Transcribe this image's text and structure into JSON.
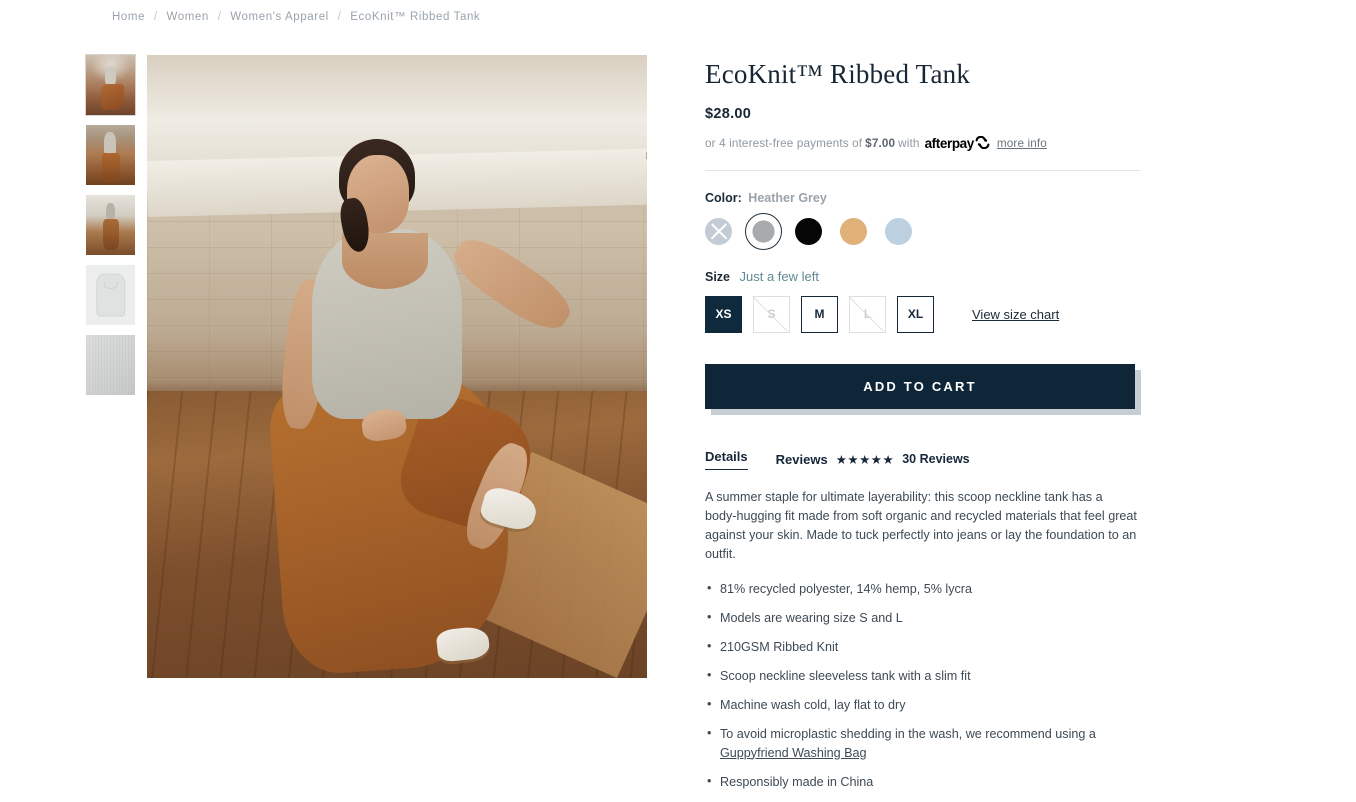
{
  "breadcrumb": {
    "items": [
      "Home",
      "Women",
      "Women's Apparel",
      "EcoKnit™ Ribbed Tank"
    ],
    "separator": "/"
  },
  "gallery": {
    "thumbnails": [
      {
        "name": "model-seated-front",
        "alt": "Model seated against wall wearing tank"
      },
      {
        "name": "model-back-view",
        "alt": "Back view of model in tank"
      },
      {
        "name": "model-standing-window",
        "alt": "Model standing near window"
      },
      {
        "name": "product-flat-lay",
        "alt": "Flat lay of heather grey ribbed tank"
      },
      {
        "name": "fabric-closeup",
        "alt": "Close up of ribbed knit fabric"
      }
    ],
    "hero_alt": "Model in heather grey ribbed tank and rust trousers seated on wooden floor"
  },
  "product": {
    "title": "EcoKnit™ Ribbed Tank",
    "price": "$28.00"
  },
  "afterpay": {
    "prefix": "or 4 interest-free payments of",
    "installment": "$7.00",
    "with": "with",
    "brand": "afterpay",
    "more_info": "more info"
  },
  "color": {
    "label": "Color:",
    "selected": "Heather Grey",
    "swatches": [
      {
        "name": "white",
        "hex": "#c3ccd4",
        "state": "disabled"
      },
      {
        "name": "Heather Grey",
        "hex": "#a9aaac",
        "state": "selected"
      },
      {
        "name": "Black",
        "hex": "#060606",
        "state": "available"
      },
      {
        "name": "Tan",
        "hex": "#e0b178",
        "state": "available"
      },
      {
        "name": "Light Blue",
        "hex": "#bdd0e0",
        "state": "available"
      }
    ]
  },
  "size": {
    "label": "Size",
    "stock_note": "Just a few left",
    "options": [
      {
        "label": "XS",
        "state": "selected"
      },
      {
        "label": "S",
        "state": "soldout"
      },
      {
        "label": "M",
        "state": "available"
      },
      {
        "label": "L",
        "state": "soldout"
      },
      {
        "label": "XL",
        "state": "available"
      }
    ],
    "size_chart_link": "View size chart"
  },
  "cart": {
    "add_to_cart": "ADD TO CART"
  },
  "tabs": {
    "details": "Details",
    "reviews": "Reviews",
    "stars": "★★★★★",
    "review_count": "30 Reviews"
  },
  "details": {
    "description": "A summer staple for ultimate layerability: this scoop neckline tank has a body-hugging fit made from soft organic and recycled materials that feel great against your skin. Made to tuck perfectly into jeans or lay the foundation to an outfit.",
    "bullets": [
      {
        "text": "81% recycled polyester, 14% hemp, 5% lycra"
      },
      {
        "text": "Models are wearing size S and L"
      },
      {
        "text": "210GSM Ribbed Knit"
      },
      {
        "text": "Scoop neckline sleeveless tank with a slim fit"
      },
      {
        "text": "Machine wash cold, lay flat to dry"
      },
      {
        "text": "To avoid microplastic shedding in the wash, we recommend using a ",
        "link": "Guppyfriend Washing Bag"
      },
      {
        "text": "Responsibly made in China"
      }
    ]
  },
  "colors": {
    "accent_navy": "#0e2637",
    "stock_teal": "#5f8a93",
    "muted_text": "#9aa3ab"
  }
}
